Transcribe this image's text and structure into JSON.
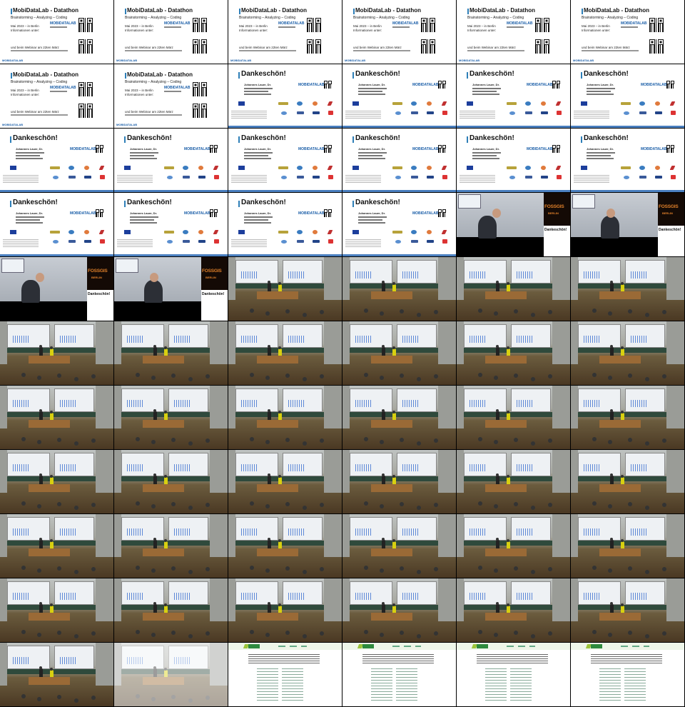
{
  "slides": {
    "datathon": {
      "title": "MobiDataLab - Datathon",
      "subtitle": "Brainstorming – Analyzing – Coding",
      "line_date": "Mai 2023 – in Berlin",
      "line_info": "Informationen unter:",
      "line_webinar": "und beim Webinar am 22ten März",
      "logo_text": "MOBIDATALAB",
      "footer": "MOBIDATALAB"
    },
    "danke": {
      "title": "Dankeschön!",
      "name": "Johannes Lauer, Dr.",
      "logo_text": "MOBIDATALAB"
    },
    "poster": {
      "fossgis": "FOSSGIS",
      "city": "BERLIN",
      "mini_title": "Dankeschön!"
    }
  },
  "colors": {
    "slide_accent": "#2e7fb8",
    "logo_blue": "#1a5ea8",
    "speaker_shirt_yellow": "#d8d010",
    "poster_orange": "#e0802a",
    "web_green": "#2e8a3e"
  },
  "grid": {
    "columns": 6,
    "rows": 11,
    "cells": [
      "datathon",
      "datathon",
      "datathon",
      "datathon",
      "datathon",
      "datathon",
      "datathon",
      "datathon",
      "danke",
      "danke",
      "danke",
      "danke",
      "danke",
      "danke",
      "danke",
      "danke",
      "danke",
      "danke",
      "danke",
      "danke",
      "danke",
      "danke",
      "speaker-closeup",
      "speaker-closeup",
      "speaker-closeup",
      "speaker-closeup",
      "hall",
      "hall",
      "hall",
      "hall",
      "hall",
      "hall",
      "hall",
      "hall",
      "hall",
      "hall",
      "hall",
      "hall",
      "hall",
      "hall",
      "hall",
      "hall",
      "hall",
      "hall",
      "hall",
      "hall",
      "hall",
      "hall",
      "hall",
      "hall",
      "hall",
      "hall",
      "hall",
      "hall",
      "hall",
      "hall",
      "hall",
      "hall",
      "hall",
      "hall",
      "hall",
      "hall-faded",
      "webpage",
      "webpage",
      "webpage",
      "webpage"
    ]
  }
}
